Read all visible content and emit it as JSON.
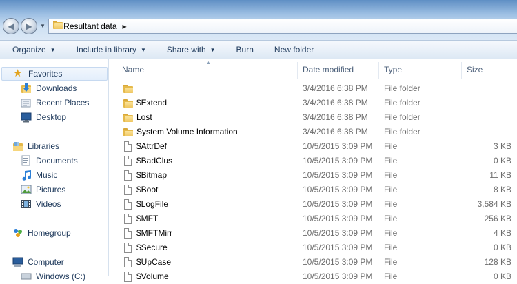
{
  "address": {
    "path": [
      "Resultant data"
    ]
  },
  "toolbar": {
    "organize": "Organize",
    "include_in_library": "Include in library",
    "share_with": "Share with",
    "burn": "Burn",
    "new_folder": "New folder"
  },
  "navigation": {
    "favorites": "Favorites",
    "downloads": "Downloads",
    "recent_places": "Recent Places",
    "desktop": "Desktop",
    "libraries": "Libraries",
    "documents": "Documents",
    "music": "Music",
    "pictures": "Pictures",
    "videos": "Videos",
    "homegroup": "Homegroup",
    "computer": "Computer",
    "windows_c": "Windows (C:)"
  },
  "columns": {
    "name": "Name",
    "date_modified": "Date modified",
    "type": "Type",
    "size": "Size"
  },
  "files": [
    {
      "name": "",
      "date": "3/4/2016 6:38 PM",
      "type": "File folder",
      "size": "",
      "icon": "folder-icon"
    },
    {
      "name": "$Extend",
      "date": "3/4/2016 6:38 PM",
      "type": "File folder",
      "size": "",
      "icon": "folder-icon"
    },
    {
      "name": "Lost",
      "date": "3/4/2016 6:38 PM",
      "type": "File folder",
      "size": "",
      "icon": "folder-icon"
    },
    {
      "name": "System Volume Information",
      "date": "3/4/2016 6:38 PM",
      "type": "File folder",
      "size": "",
      "icon": "folder-icon"
    },
    {
      "name": "$AttrDef",
      "date": "10/5/2015 3:09 PM",
      "type": "File",
      "size": "3 KB",
      "icon": "file-icon"
    },
    {
      "name": "$BadClus",
      "date": "10/5/2015 3:09 PM",
      "type": "File",
      "size": "0 KB",
      "icon": "file-icon"
    },
    {
      "name": "$Bitmap",
      "date": "10/5/2015 3:09 PM",
      "type": "File",
      "size": "11 KB",
      "icon": "file-icon"
    },
    {
      "name": "$Boot",
      "date": "10/5/2015 3:09 PM",
      "type": "File",
      "size": "8 KB",
      "icon": "file-icon"
    },
    {
      "name": "$LogFile",
      "date": "10/5/2015 3:09 PM",
      "type": "File",
      "size": "3,584 KB",
      "icon": "file-icon"
    },
    {
      "name": "$MFT",
      "date": "10/5/2015 3:09 PM",
      "type": "File",
      "size": "256 KB",
      "icon": "file-icon"
    },
    {
      "name": "$MFTMirr",
      "date": "10/5/2015 3:09 PM",
      "type": "File",
      "size": "4 KB",
      "icon": "file-icon"
    },
    {
      "name": "$Secure",
      "date": "10/5/2015 3:09 PM",
      "type": "File",
      "size": "0 KB",
      "icon": "file-icon"
    },
    {
      "name": "$UpCase",
      "date": "10/5/2015 3:09 PM",
      "type": "File",
      "size": "128 KB",
      "icon": "file-icon"
    },
    {
      "name": "$Volume",
      "date": "10/5/2015 3:09 PM",
      "type": "File",
      "size": "0 KB",
      "icon": "file-icon"
    }
  ]
}
